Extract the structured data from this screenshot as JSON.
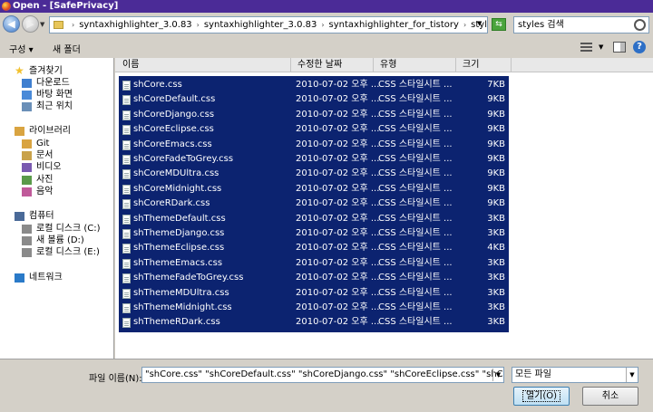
{
  "window": {
    "title": "Open - [SafePrivacy]"
  },
  "address": {
    "crumbs": [
      "syntaxhighlighter_3.0.83",
      "syntaxhighlighter_3.0.83",
      "syntaxhighlighter_for_tistory",
      "styles"
    ],
    "separator": "›",
    "search_placeholder": "styles 검색"
  },
  "toolbar": {
    "organize_label": "구성 ▾",
    "new_folder_label": "새 폴더"
  },
  "icons": {
    "back": "back-arrow-icon",
    "forward": "forward-arrow-icon",
    "refresh": "refresh-icon",
    "search": "search-icon",
    "help": "help-icon"
  },
  "nav": [
    {
      "label": "즐겨찾기",
      "icon": "star-icon",
      "indent": 0,
      "selected": true
    },
    {
      "label": "다운로드",
      "icon": "downloads-icon",
      "indent": 1
    },
    {
      "label": "바탕 화면",
      "icon": "desktop-icon",
      "indent": 1
    },
    {
      "label": "최근 위치",
      "icon": "recent-places-icon",
      "indent": 1
    },
    {
      "label": "라이브러리",
      "icon": "library-icon",
      "indent": 0
    },
    {
      "label": "Git",
      "icon": "git-library-icon",
      "indent": 1
    },
    {
      "label": "문서",
      "icon": "documents-icon",
      "indent": 1
    },
    {
      "label": "비디오",
      "icon": "video-icon",
      "indent": 1
    },
    {
      "label": "사진",
      "icon": "pictures-icon",
      "indent": 1
    },
    {
      "label": "음악",
      "icon": "music-icon",
      "indent": 1
    },
    {
      "label": "컴퓨터",
      "icon": "computer-icon",
      "indent": 0
    },
    {
      "label": "로컬 디스크 (C:)",
      "icon": "drive-icon",
      "indent": 1
    },
    {
      "label": "새 볼륨 (D:)",
      "icon": "drive-icon",
      "indent": 1
    },
    {
      "label": "로컬 디스크 (E:)",
      "icon": "drive-icon",
      "indent": 1
    },
    {
      "label": "네트워크",
      "icon": "network-icon",
      "indent": 0
    }
  ],
  "columns": {
    "name": "이름",
    "date": "수정한 날짜",
    "type": "유형",
    "size": "크기"
  },
  "files": [
    {
      "name": "shCore.css",
      "date": "2010-07-02 오후 ...",
      "type": "CSS 스타일시트 ...",
      "size": "7KB"
    },
    {
      "name": "shCoreDefault.css",
      "date": "2010-07-02 오후 ...",
      "type": "CSS 스타일시트 ...",
      "size": "9KB"
    },
    {
      "name": "shCoreDjango.css",
      "date": "2010-07-02 오후 ...",
      "type": "CSS 스타일시트 ...",
      "size": "9KB"
    },
    {
      "name": "shCoreEclipse.css",
      "date": "2010-07-02 오후 ...",
      "type": "CSS 스타일시트 ...",
      "size": "9KB"
    },
    {
      "name": "shCoreEmacs.css",
      "date": "2010-07-02 오후 ...",
      "type": "CSS 스타일시트 ...",
      "size": "9KB"
    },
    {
      "name": "shCoreFadeToGrey.css",
      "date": "2010-07-02 오후 ...",
      "type": "CSS 스타일시트 ...",
      "size": "9KB"
    },
    {
      "name": "shCoreMDUltra.css",
      "date": "2010-07-02 오후 ...",
      "type": "CSS 스타일시트 ...",
      "size": "9KB"
    },
    {
      "name": "shCoreMidnight.css",
      "date": "2010-07-02 오후 ...",
      "type": "CSS 스타일시트 ...",
      "size": "9KB"
    },
    {
      "name": "shCoreRDark.css",
      "date": "2010-07-02 오후 ...",
      "type": "CSS 스타일시트 ...",
      "size": "9KB"
    },
    {
      "name": "shThemeDefault.css",
      "date": "2010-07-02 오후 ...",
      "type": "CSS 스타일시트 ...",
      "size": "3KB"
    },
    {
      "name": "shThemeDjango.css",
      "date": "2010-07-02 오후 ...",
      "type": "CSS 스타일시트 ...",
      "size": "3KB"
    },
    {
      "name": "shThemeEclipse.css",
      "date": "2010-07-02 오후 ...",
      "type": "CSS 스타일시트 ...",
      "size": "4KB"
    },
    {
      "name": "shThemeEmacs.css",
      "date": "2010-07-02 오후 ...",
      "type": "CSS 스타일시트 ...",
      "size": "3KB"
    },
    {
      "name": "shThemeFadeToGrey.css",
      "date": "2010-07-02 오후 ...",
      "type": "CSS 스타일시트 ...",
      "size": "3KB"
    },
    {
      "name": "shThemeMDUltra.css",
      "date": "2010-07-02 오후 ...",
      "type": "CSS 스타일시트 ...",
      "size": "3KB"
    },
    {
      "name": "shThemeMidnight.css",
      "date": "2010-07-02 오후 ...",
      "type": "CSS 스타일시트 ...",
      "size": "3KB"
    },
    {
      "name": "shThemeRDark.css",
      "date": "2010-07-02 오후 ...",
      "type": "CSS 스타일시트 ...",
      "size": "3KB"
    }
  ],
  "footer": {
    "filename_label": "파일 이름(N):",
    "filename_value": "\"shCore.css\" \"shCoreDefault.css\" \"shCoreDjango.css\" \"shCoreEclipse.css\" \"shCoreEmacs.css\" \"sh",
    "filter_value": "모든 파일",
    "open_label": "열기(O)",
    "cancel_label": "취소"
  },
  "colors": {
    "title_bar": "#4b2b97",
    "selection": "#0c2370"
  }
}
